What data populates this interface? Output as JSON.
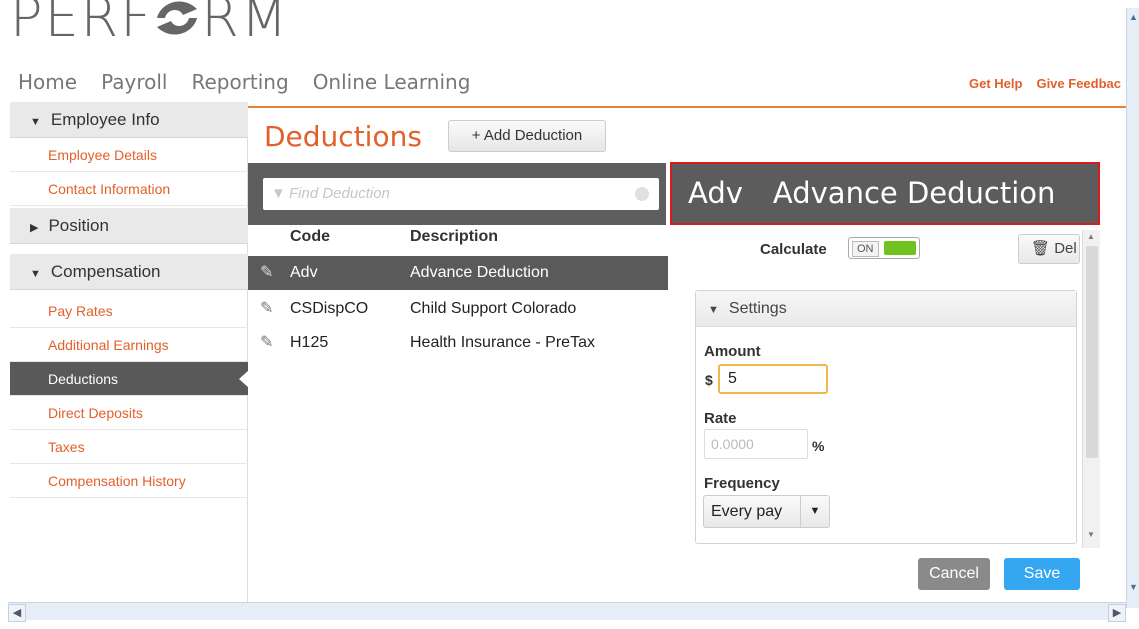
{
  "header": {
    "logo_text_left": "PERF",
    "logo_text_right": "RM",
    "nav": [
      "Home",
      "Payroll",
      "Reporting",
      "Online Learning"
    ],
    "links": [
      "Get Help",
      "Give Feedbac"
    ]
  },
  "sidebar": {
    "sections": [
      {
        "label": "Employee Info",
        "expanded": true
      },
      {
        "label": "Position",
        "expanded": false
      },
      {
        "label": "Compensation",
        "expanded": true
      }
    ],
    "employee_items": [
      "Employee Details",
      "Contact Information"
    ],
    "compensation_items": [
      "Pay Rates",
      "Additional Earnings",
      "Deductions",
      "Direct Deposits",
      "Taxes",
      "Compensation History"
    ],
    "active_item": "Deductions"
  },
  "main": {
    "title": "Deductions",
    "add_button": "Add Deduction",
    "search_placeholder": "Find Deduction",
    "columns": {
      "code": "Code",
      "description": "Description"
    },
    "rows": [
      {
        "code": "Adv",
        "description": "Advance Deduction",
        "selected": true
      },
      {
        "code": "CSDispCO",
        "description": "Child Support  Colorado",
        "selected": false
      },
      {
        "code": "H125",
        "description": "Health Insurance - PreTax",
        "selected": false
      }
    ]
  },
  "detail": {
    "code": "Adv",
    "name": "Advance Deduction",
    "calculate_label": "Calculate",
    "toggle_state": "ON",
    "delete_button": "Del",
    "settings_label": "Settings",
    "amount_label": "Amount",
    "currency": "$",
    "amount_value": "5",
    "rate_label": "Rate",
    "rate_placeholder": "0.0000",
    "rate_unit": "%",
    "frequency_label": "Frequency",
    "frequency_value": "Every pay",
    "cancel_button": "Cancel",
    "save_button": "Save"
  },
  "colors": {
    "accent_orange": "#e2602b",
    "save_blue": "#35a7f0",
    "highlight_red": "#d71b1b"
  }
}
